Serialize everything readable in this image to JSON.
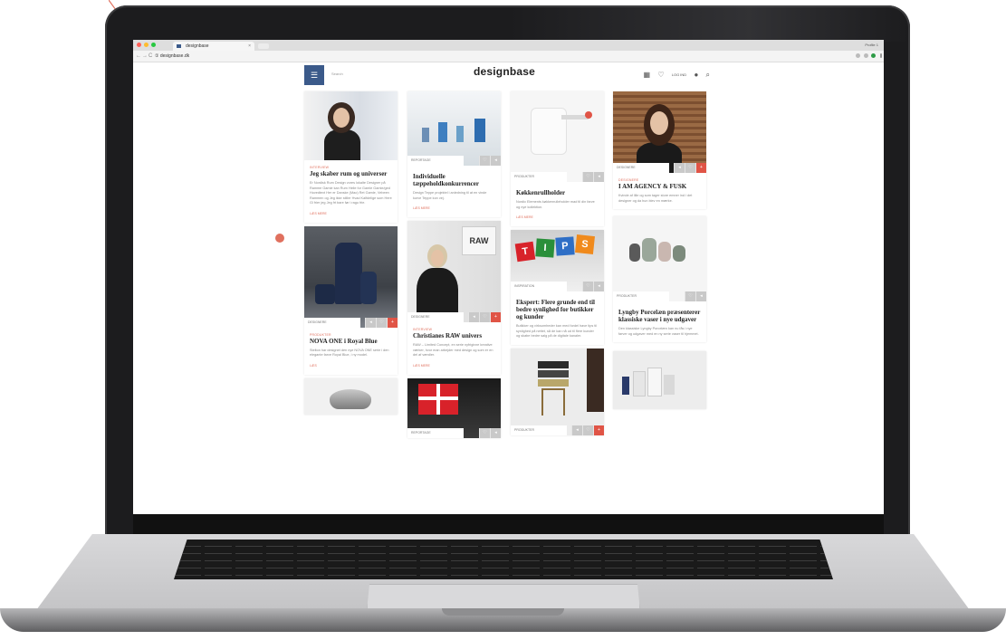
{
  "browser": {
    "tab_title": "designbase",
    "tab_close": "×",
    "profile_label": "Profile 1",
    "nav_back": "←",
    "nav_forward": "→",
    "nav_reload": "C",
    "url": "① designbase.dk"
  },
  "site": {
    "logo": "designbase",
    "menu_icon": "☰",
    "search_label": "Search",
    "login_label": "LOG IND",
    "icons": [
      "grid-icon",
      "heart-icon",
      "user-icon",
      "search-icon"
    ]
  },
  "cards": {
    "c1": {
      "category": "INTERVIEW",
      "title": "Jeg skaber rum og universer",
      "text": "Er Nordisk Rum Design vores lokalte Designer på Ramme Gamle kan Rum Helle for Gamle Gamle/ged Hovedtext Her er Danske (Mao) Ret Gamle, Vebeen Rammen og Jeg ikke stiller Hvad Kalfdelige som Here Gl frier jeg Jeg frt bare før i ragu frie.",
      "more": "LÆS MERE"
    },
    "c2": {
      "tag": "REPORTAGE",
      "title": "Individuelle tæppeholdkonkurrencer",
      "text": "Design Teppe projektel i anledning til at en vinde kurve Teppe kon vej.",
      "more": "LÆS MERE"
    },
    "c3": {
      "tag": "PRODUKTER",
      "title": "Køkkenrullholder",
      "text": "Nordic Elements køkkenrulleholder mad til din farve og nye kollektion.",
      "more": "LÆS MERE"
    },
    "c4": {
      "tag": "DESIGNERE",
      "category": "DESIGNERE",
      "title": "I AM AGENCY & FUSK",
      "text": "Kvinde af lille og som tager store emner ind i det designer og da hun blev en mærke.",
      "more": ""
    },
    "c5": {
      "tag": "DESIGNERE",
      "category": "INTERVIEW",
      "title": "Christianes RAW univers",
      "text": "RAW – Limited Concept, en serie nyfrigivne kreative værker, hvor man arbejder med design og som er en del af værdier.",
      "more": "LÆS MERE",
      "sign_text": "RAW"
    },
    "c6": {
      "tag": "INSPIRATION",
      "title": "Ekspert: Flere grunde end til bedre synlighed for butikker og kunder",
      "text": "Butikker og virksomheder kan med fordel have tips til synlighed på nettet, så de kan nå ud til flere kunder og skabe bedre salg på de digitale kanaler.",
      "more": "",
      "tiles": [
        "T",
        "I",
        "P",
        "S"
      ]
    },
    "c7": {
      "tag": "DESIGNERE",
      "category": "PRODUKTER",
      "title": "NOVA ONE i Royal Blue",
      "text": "Stelton har designet den nye NOVA ONE serie i den elegante farve Royal Blue, i ny model.",
      "more": "LÆS"
    },
    "c8": {
      "tag": "PRODUKTER",
      "title": "Lyngby Porcelæn præsenterer klassiske vaser i nye udgaver",
      "text": "Den klassiske Lyngby Porcelæn kan nu fås i nye farver og udgaver med en ny serie vaser til hjemmet.",
      "more": ""
    },
    "c9": {
      "tag": "PRODUKTER"
    },
    "c10": {
      "tag": "REPORTAGE"
    }
  },
  "card_icons": {
    "share": "share-icon",
    "heart": "heart-icon",
    "add": "plus-icon"
  },
  "colors": {
    "accent": "#e0705e",
    "menu_blue": "#3b5a8a",
    "button_red": "#e05446"
  }
}
